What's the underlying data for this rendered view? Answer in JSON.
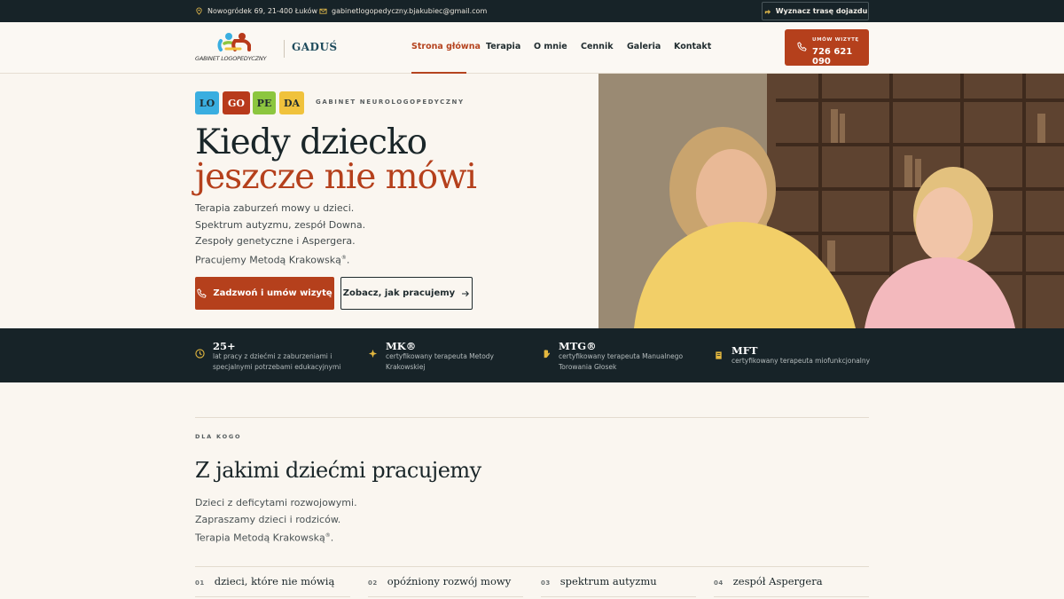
{
  "topbar": {
    "address": "Nowogródek 69, 21-400 Łuków",
    "email": "gabinetlogopedyczny.bjakubiec@gmail.com",
    "route_button": "Wyznacz trasę dojazdu"
  },
  "header": {
    "logo_text": "GABINET LOGOPEDYCZNY",
    "brand": "GADUŚ",
    "nav": [
      "Strona główna",
      "Terapia",
      "O mnie",
      "Cennik",
      "Galeria",
      "Kontakt"
    ],
    "call_label": "UMÓW WIZYTĘ",
    "call_number": "726 621 090"
  },
  "hero": {
    "tiles": [
      "LO",
      "GO",
      "PE",
      "DA"
    ],
    "tile_colors": [
      "#3aaee0",
      "#b83a1b",
      "#8cc63f",
      "#f0c23c"
    ],
    "tag": "GABINET NEUROLOGOPEDYCZNY",
    "title_line1": "Kiedy dziecko",
    "title_line2": "jeszcze nie mówi",
    "lines": [
      "Terapia zaburzeń mowy u dzieci.",
      "Spektrum autyzmu, zespół Downa.",
      "Zespoły genetyczne i Aspergera.",
      "Pracujemy Metodą Krakowską"
    ],
    "reg_mark": "®",
    "reg_suffix": ".",
    "cta_primary": "Zadzwoń i umów wizytę",
    "cta_secondary": "Zobacz, jak pracujemy"
  },
  "stats": [
    {
      "title": "25+",
      "desc": "lat pracy z dziećmi z zaburzeniami i specjalnymi potrzebami edukacyjnymi",
      "icon": "clock-icon"
    },
    {
      "title": "MK®",
      "desc": "certyfikowany terapeuta Metody Krakowskiej",
      "icon": "sparkle-icon"
    },
    {
      "title": "MTG®",
      "desc": "certyfikowany terapeuta Manualnego Torowania Głosek",
      "icon": "hand-icon"
    },
    {
      "title": "MFT",
      "desc": "certyfikowany terapeuta miofunkcjonalny",
      "icon": "book-icon"
    }
  ],
  "section": {
    "tag": "DLA KOGO",
    "title": "Z jakimi dziećmi pracujemy",
    "lines": [
      "Dzieci z deficytami rozwojowymi.",
      "Zapraszamy dzieci i rodziców.",
      "Terapia Metodą Krakowską"
    ],
    "reg_mark": "®",
    "reg_suffix": ".",
    "cards": [
      {
        "num": "01",
        "text": "dzieci, które nie mówią"
      },
      {
        "num": "02",
        "text": "opóźniony rozwój mowy"
      },
      {
        "num": "03",
        "text": "spektrum autyzmu"
      },
      {
        "num": "04",
        "text": "zespół Aspergera"
      }
    ]
  },
  "colors": {
    "accent": "#b5401c",
    "dark": "#172328",
    "background": "#faf6f0"
  }
}
